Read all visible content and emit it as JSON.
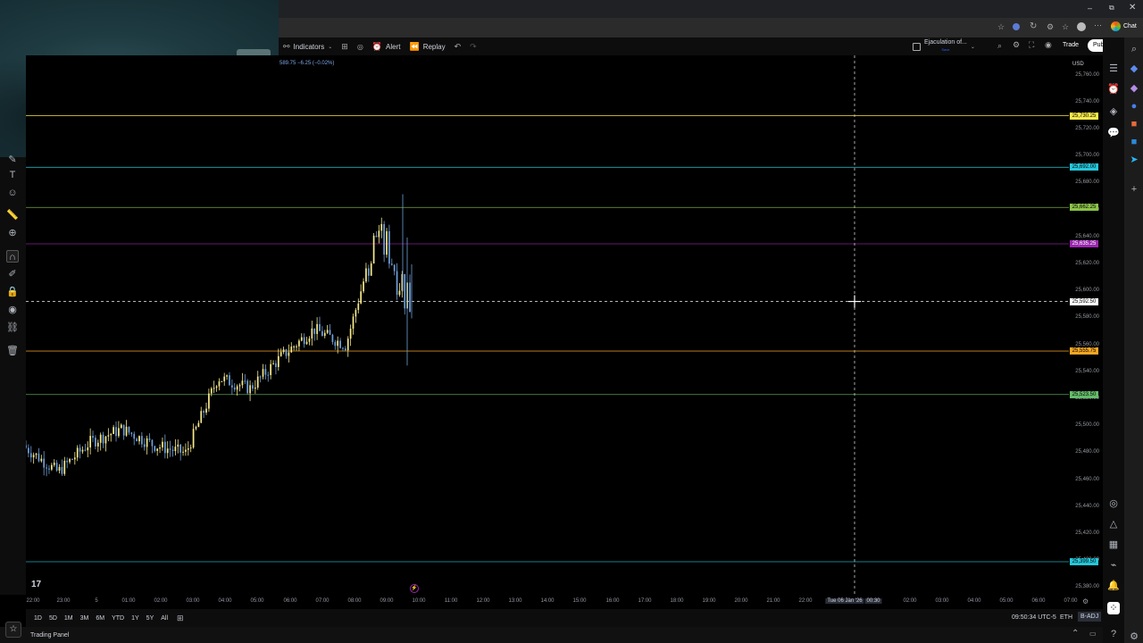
{
  "browser": {
    "chat_label": "Chat",
    "window_controls": [
      "minimize-icon",
      "restore-icon",
      "close-icon"
    ]
  },
  "toolbar": {
    "indicators_label": "Indicators",
    "alert_label": "Alert",
    "replay_label": "Replay",
    "layout_title": "Ejaculation of...",
    "layout_subtitle": "Save",
    "trade_label": "Trade",
    "publish_label": "Publish"
  },
  "legend": {
    "price_change": "589.75 −6.25 (−0.02%)"
  },
  "price_axis": {
    "currency": "USD",
    "ticks": [
      "25,760.00",
      "25,740.00",
      "25,720.00",
      "25,700.00",
      "25,680.00",
      "25,660.00",
      "25,640.00",
      "25,620.00",
      "25,600.00",
      "25,580.00",
      "25,560.00",
      "25,540.00",
      "25,520.00",
      "25,500.00",
      "25,480.00",
      "25,460.00",
      "25,440.00",
      "25,420.00",
      "25,400.00",
      "25,380.00"
    ],
    "levels": [
      {
        "price": "25,730.25",
        "color": "#f7e94a"
      },
      {
        "price": "25,692.00",
        "color": "#26c6da"
      },
      {
        "price": "25,662.25",
        "color": "#8bc34a"
      },
      {
        "price": "25,635.25",
        "color": "#9c27b0"
      },
      {
        "price": "25,592.50",
        "color": "#ffffff"
      },
      {
        "price": "25,555.75",
        "color": "#f5a623"
      },
      {
        "price": "25,523.50",
        "color": "#66bb6a"
      },
      {
        "price": "25,399.50",
        "color": "#26c6da"
      }
    ],
    "current_price_tag": "25,592.50"
  },
  "time_axis": {
    "ticks": [
      "22:00",
      "23:00",
      "5",
      "01:00",
      "02:00",
      "03:00",
      "04:00",
      "05:00",
      "06:00",
      "07:00",
      "08:00",
      "09:00",
      "10:00",
      "11:00",
      "12:00",
      "13:00",
      "14:00",
      "15:00",
      "16:00",
      "17:00",
      "18:00",
      "19:00",
      "20:00",
      "21:00",
      "22:00",
      "23:00",
      "Tue 06 Jan '26",
      "00:30",
      "02:00",
      "03:00",
      "04:00",
      "05:00",
      "06:00",
      "07:00"
    ]
  },
  "range_bar": {
    "ranges": [
      "1D",
      "5D",
      "1M",
      "3M",
      "6M",
      "YTD",
      "1Y",
      "5Y",
      "All"
    ],
    "clock": "09:50:34 UTC-5",
    "session": "ETH",
    "adj": "B-ADJ"
  },
  "bottom": {
    "panel_label": "Trading Panel"
  },
  "colors": {
    "up": "#f5e88a",
    "down": "#6f9fd8",
    "background": "#000000"
  },
  "chart_data": {
    "type": "candlestick",
    "ylim": [
      25375,
      25775
    ],
    "candles_sampled": [
      {
        "t": "22:00",
        "o": 25486,
        "h": 25490,
        "l": 25480,
        "c": 25484
      },
      {
        "t": "23:00",
        "o": 25472,
        "h": 25478,
        "l": 25462,
        "c": 25466
      },
      {
        "t": "00:00",
        "o": 25478,
        "h": 25492,
        "l": 25474,
        "c": 25488
      },
      {
        "t": "01:00",
        "o": 25490,
        "h": 25502,
        "l": 25484,
        "c": 25498
      },
      {
        "t": "02:00",
        "o": 25496,
        "h": 25508,
        "l": 25482,
        "c": 25486
      },
      {
        "t": "03:00",
        "o": 25472,
        "h": 25488,
        "l": 25458,
        "c": 25480
      },
      {
        "t": "04:00",
        "o": 25540,
        "h": 25560,
        "l": 25528,
        "c": 25536
      },
      {
        "t": "05:00",
        "o": 25520,
        "h": 25534,
        "l": 25504,
        "c": 25528
      },
      {
        "t": "06:00",
        "o": 25546,
        "h": 25556,
        "l": 25536,
        "c": 25552
      },
      {
        "t": "07:00",
        "o": 25566,
        "h": 25590,
        "l": 25556,
        "c": 25572
      },
      {
        "t": "08:00",
        "o": 25548,
        "h": 25568,
        "l": 25524,
        "c": 25560
      },
      {
        "t": "09:00",
        "o": 25608,
        "h": 25670,
        "l": 25580,
        "c": 25646
      },
      {
        "t": "09:30",
        "o": 25620,
        "h": 25660,
        "l": 25540,
        "c": 25594
      }
    ]
  }
}
